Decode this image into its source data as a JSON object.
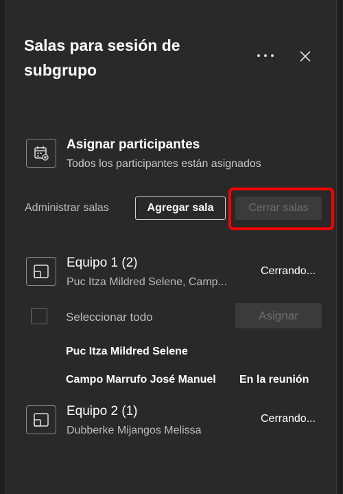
{
  "header": {
    "title": "Salas para sesión de subgrupo",
    "more_icon": "more-options-icon",
    "close_icon": "close-icon"
  },
  "assign": {
    "icon": "assign-calendar-icon",
    "title": "Asignar participantes",
    "subtitle": "Todos los participantes están asignados"
  },
  "manage": {
    "label": "Administrar salas",
    "add_button": "Agregar sala",
    "close_button": "Cerrar salas",
    "highlight_color": "#ff0000"
  },
  "rooms": [
    {
      "name": "Equipo 1 (2)",
      "members": "Puc Itza Mildred Selene, Camp...",
      "status": "Cerrando...",
      "icon": "room-icon"
    },
    {
      "name": "Equipo 2 (1)",
      "members": "Dubberke Mijangos Melissa",
      "status": "Cerrando...",
      "icon": "room-icon"
    }
  ],
  "room1_expanded": {
    "select_all": "Seleccionar todo",
    "assign_button": "Asignar",
    "participants": [
      {
        "name": "Puc Itza Mildred Selene",
        "status": ""
      },
      {
        "name": "Campo Marrufo José Manuel",
        "status": "En la reunión"
      }
    ]
  }
}
